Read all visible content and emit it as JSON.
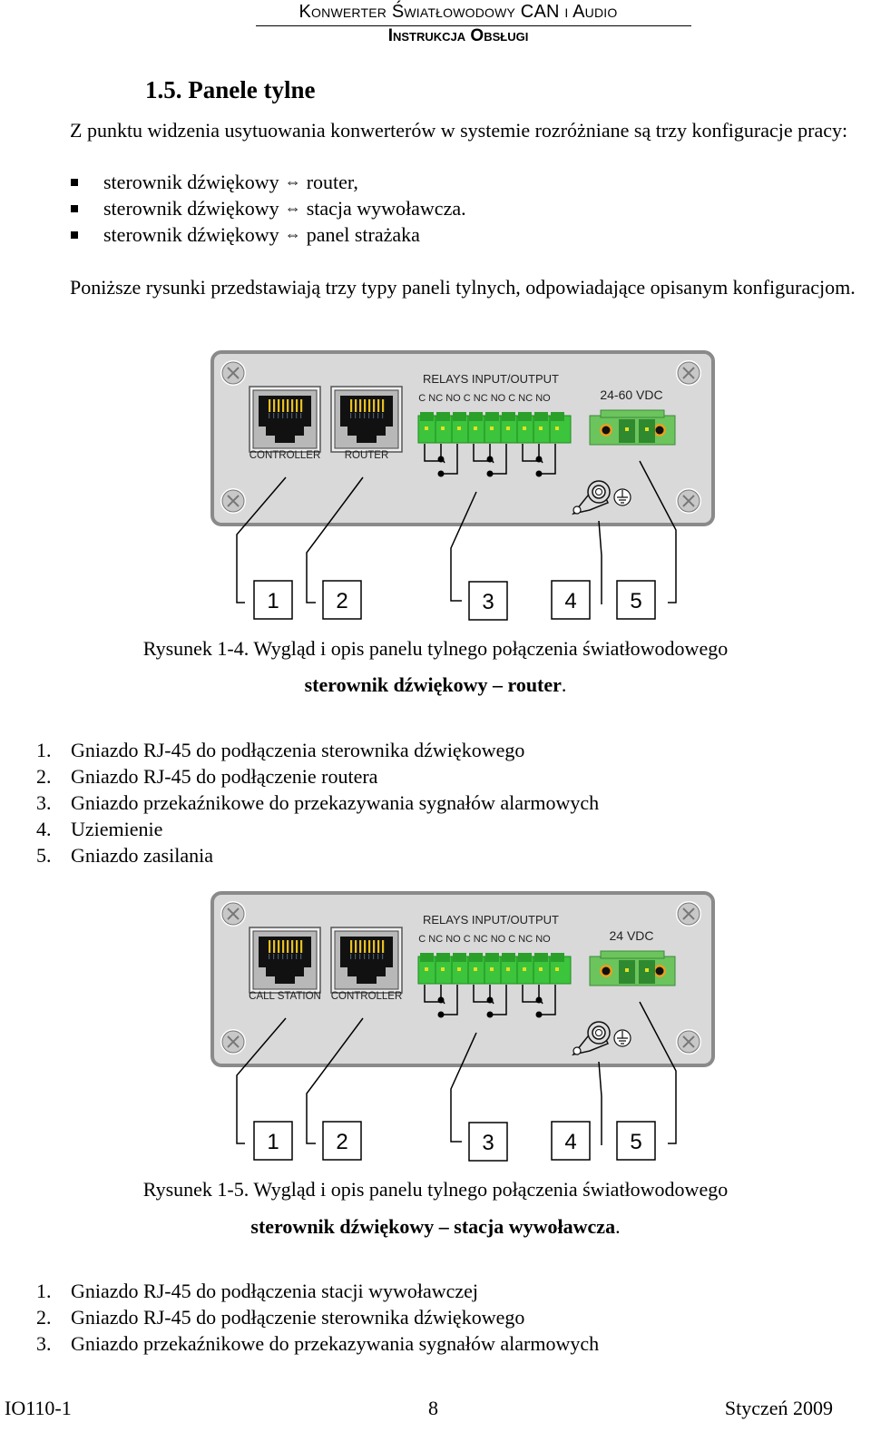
{
  "header": {
    "title": "Konwerter Światłowodowy CAN i Audio",
    "subtitle": "Instrukcja Obsługi"
  },
  "section": {
    "heading": "1.5. Panele tylne",
    "intro": "Z punktu widzenia usytuowania konwerterów w systemie rozróżniane są trzy konfiguracje pracy:",
    "config_list": [
      {
        "left": "sterownik dźwiękowy",
        "arrow": "⇔",
        "right": "router,"
      },
      {
        "left": "sterownik dźwiękowy",
        "arrow": "⇔",
        "right": "stacja wywoławcza."
      },
      {
        "left": "sterownik dźwiękowy",
        "arrow": "⇔",
        "right": "panel strażaka"
      }
    ],
    "figures_intro": "Poniższe rysunki przedstawiają trzy typy paneli tylnych, odpowiadające opisanym konfiguracjom."
  },
  "figures": [
    {
      "panel": {
        "port1_label": "CONTROLLER",
        "port2_label": "ROUTER",
        "relays_title": "RELAYS INPUT/OUTPUT",
        "relay_pins": "C  NC  NO C  NC  NO C  NC NO",
        "power_label": "24-60 VDC",
        "callouts": [
          "1",
          "2",
          "3",
          "4",
          "5"
        ]
      },
      "caption": "Rysunek 1-4. Wygląd i opis panelu tylnego połączenia światłowodowego",
      "caption_bold": "sterownik dźwiękowy – router",
      "caption_end": ".",
      "legend": [
        {
          "n": "1.",
          "text": "Gniazdo RJ-45 do podłączenia sterownika dźwiękowego"
        },
        {
          "n": "2.",
          "text": "Gniazdo RJ-45 do podłączenie routera"
        },
        {
          "n": "3.",
          "text": "Gniazdo przekaźnikowe do przekazywania sygnałów alarmowych"
        },
        {
          "n": "4.",
          "text": "Uziemienie"
        },
        {
          "n": "5.",
          "text": "Gniazdo zasilania"
        }
      ]
    },
    {
      "panel": {
        "port1_label": "CALL STATION",
        "port2_label": "CONTROLLER",
        "relays_title": "RELAYS INPUT/OUTPUT",
        "relay_pins": "C  NC  NO C  NC  NO C  NC NO",
        "power_label": "24 VDC",
        "callouts": [
          "1",
          "2",
          "3",
          "4",
          "5"
        ]
      },
      "caption": "Rysunek 1-5. Wygląd i opis panelu tylnego połączenia światłowodowego",
      "caption_bold": "sterownik dźwiękowy – stacja wywoławcza",
      "caption_end": ".",
      "legend": [
        {
          "n": "1.",
          "text": "Gniazdo RJ-45 do podłączenia stacji wywoławczej"
        },
        {
          "n": "2.",
          "text": "Gniazdo RJ-45 do podłączenie sterownika dźwiękowego"
        },
        {
          "n": "3.",
          "text": "Gniazdo przekaźnikowe do przekazywania sygnałów alarmowych"
        }
      ]
    }
  ],
  "footer": {
    "doc_id": "IO110-1",
    "page": "8",
    "date": "Styczeń 2009"
  },
  "colors": {
    "panel_fill": "#d9d9d9",
    "panel_border": "#8a8a8a",
    "terminal_green": "#3cc43c",
    "power_green": "#6cc45c",
    "pin_gold": "#e8c020"
  }
}
